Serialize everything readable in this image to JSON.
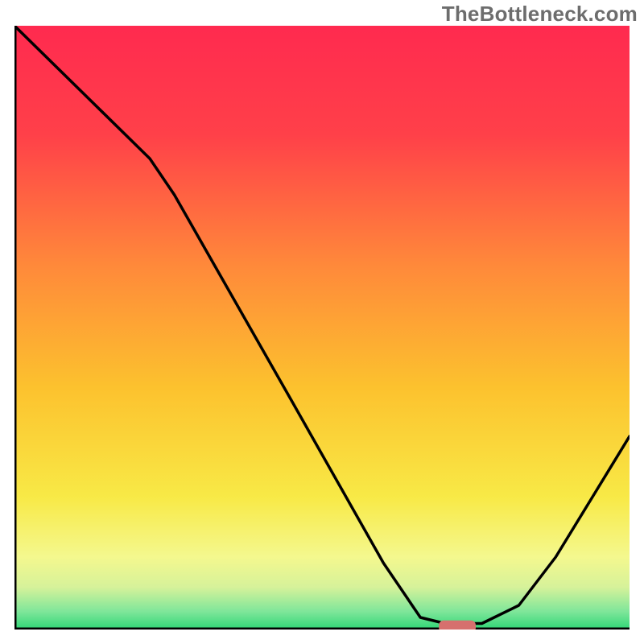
{
  "watermark": "TheBottleneck.com",
  "chart_data": {
    "type": "line",
    "title": "",
    "xlabel": "",
    "ylabel": "",
    "xlim": [
      0,
      100
    ],
    "ylim": [
      0,
      100
    ],
    "grid": false,
    "series": [
      {
        "name": "bottleneck-curve",
        "description": "Bottleneck percentage vs component balance (x = relative position, y = bottleneck %). Values inferred from pixel heights; chart has no labeled axes.",
        "x": [
          0,
          8,
          22,
          26,
          45,
          60,
          66,
          70,
          76,
          82,
          88,
          94,
          100
        ],
        "values": [
          100,
          92,
          78,
          72,
          38,
          11,
          2,
          1,
          1,
          4,
          12,
          22,
          32
        ]
      }
    ],
    "annotations": [
      {
        "name": "optimal-marker",
        "type": "pill",
        "x_center": 72,
        "y_center": 0.5,
        "width": 6,
        "height": 2,
        "color": "#d6706e"
      }
    ],
    "gradient_stops": [
      {
        "offset": 0.0,
        "color": "#ff2a4f"
      },
      {
        "offset": 0.18,
        "color": "#ff4049"
      },
      {
        "offset": 0.4,
        "color": "#ff8a3a"
      },
      {
        "offset": 0.6,
        "color": "#fcc22e"
      },
      {
        "offset": 0.78,
        "color": "#f8e946"
      },
      {
        "offset": 0.88,
        "color": "#f4f88e"
      },
      {
        "offset": 0.93,
        "color": "#d6f29a"
      },
      {
        "offset": 0.97,
        "color": "#7fe69a"
      },
      {
        "offset": 1.0,
        "color": "#2fd676"
      }
    ]
  }
}
